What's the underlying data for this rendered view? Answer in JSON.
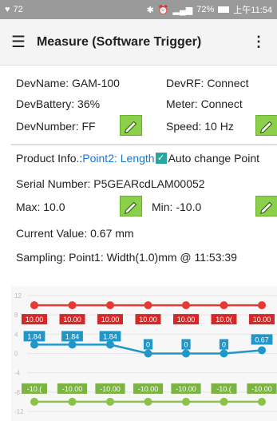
{
  "status_bar": {
    "left_text": "72",
    "battery": "72%",
    "time": "上午11:54"
  },
  "app_bar": {
    "title": "Measure (Software Trigger)"
  },
  "device": {
    "name": "DevName: GAM-100",
    "rf": "DevRF: Connect",
    "battery": "DevBattery: 36%",
    "meter": "Meter: Connect",
    "number": "DevNumber: FF",
    "speed": "Speed: 10 Hz"
  },
  "product": {
    "label": "Product Info.: ",
    "link": "Point2: Length",
    "auto_change": "Auto change Point",
    "auto_change_checked": true
  },
  "serial": "Serial Number: P5GEARcdLAM00052",
  "max": "Max: 10.0",
  "min": "Min: -10.0",
  "current_value": "Current Value: 0.67 mm",
  "sampling": "Sampling: Point1: Width(1.0)mm @ 11:53:39",
  "colors": {
    "max_line": "#e53935",
    "value_line": "#2196c8",
    "min_line": "#8bc34a"
  },
  "chart_data": {
    "type": "line",
    "x": [
      1,
      2,
      3,
      4,
      5,
      6,
      7
    ],
    "ylim": [
      -12,
      12
    ],
    "yticks": [
      "12",
      "8",
      "4",
      "0",
      "-4",
      "-8",
      "-12"
    ],
    "series": [
      {
        "role": "max",
        "values": [
          10,
          10,
          10,
          10,
          10,
          10,
          10
        ],
        "labels": [
          "10.00",
          "10.00",
          "10.00",
          "10.00",
          "10.00",
          "10.0(",
          "10.00"
        ],
        "label_color": "#d62828"
      },
      {
        "role": "value",
        "values": [
          1.84,
          1.84,
          1.84,
          0,
          0,
          0,
          0.67
        ],
        "labels": [
          "1.84",
          "1.84",
          "1.84",
          "0",
          "0",
          "0",
          "0.67"
        ],
        "label_color": "#2196c8"
      },
      {
        "role": "min",
        "values": [
          -10,
          -10,
          -10,
          -10,
          -10,
          -10,
          -10
        ],
        "labels": [
          "-10.(",
          "-10.00",
          "-10.00",
          "-10.00",
          "-10.00",
          "-10.(",
          "-10.00"
        ],
        "label_color": "#7cb342"
      }
    ]
  }
}
